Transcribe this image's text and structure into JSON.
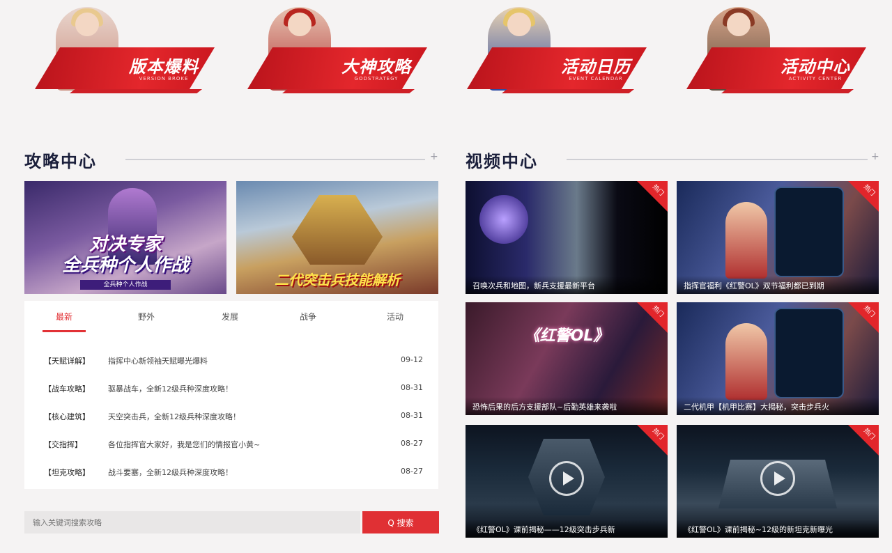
{
  "banners": [
    {
      "title": "版本爆料",
      "sub": "VERSION BROKE"
    },
    {
      "title": "大神攻略",
      "sub": "GODSTRATEGY"
    },
    {
      "title": "活动日历",
      "sub": "EVENT CALENDAR"
    },
    {
      "title": "活动中心",
      "sub": "ACTIVITY CENTER"
    }
  ],
  "guide_section": {
    "title": "攻略中心",
    "images": [
      {
        "line1": "对决专家",
        "line2": "全兵种个人作战",
        "bar": "全兵种个人作战"
      },
      {
        "line1": "",
        "line2": "二代突击兵技能解析",
        "bar": ""
      }
    ],
    "tabs": [
      "最新",
      "野外",
      "发展",
      "战争",
      "活动"
    ],
    "news": [
      {
        "cat": "【天赋详解】",
        "title": "指挥中心新领袖天赋曝光爆料",
        "date": "09-12"
      },
      {
        "cat": "【战车攻略】",
        "title": "驱暴战车，全新12级兵种深度攻略！",
        "date": "08-31"
      },
      {
        "cat": "【核心建筑】",
        "title": "天空突击兵，全新12级兵种深度攻略！",
        "date": "08-31"
      },
      {
        "cat": "【交指挥】",
        "title": "各位指挥官大家好，我是您们的情报官小黄~",
        "date": "08-27"
      },
      {
        "cat": "【坦克攻略】",
        "title": "战斗要塞，全新12级兵种深度攻略！",
        "date": "08-27"
      }
    ],
    "search": {
      "placeholder": "输入关键词搜索攻略",
      "button": "Q 搜索"
    }
  },
  "video_section": {
    "title": "视频中心",
    "videos": [
      {
        "caption": "召唤次兵和地图，新兵支援最新平台",
        "corner": "热门"
      },
      {
        "caption": "指挥官福利《红警OL》双节福利都已到期",
        "corner": "热门"
      },
      {
        "caption": "恐怖后果的后方支援部队~后勤英雄来袭啦",
        "corner": "热门",
        "big": "《红警OL》"
      },
      {
        "caption": "二代机甲【机甲比赛】大揭秘，突击步兵火",
        "corner": "热门"
      },
      {
        "caption": "《红警OL》课前揭秘——12级突击步兵新",
        "corner": "热门"
      },
      {
        "caption": "《红警OL》课前揭秘~12级的新坦克新曝光",
        "corner": "热门"
      }
    ]
  },
  "colors": {
    "accent": "#e23236",
    "navy": "#1b1f3b"
  }
}
